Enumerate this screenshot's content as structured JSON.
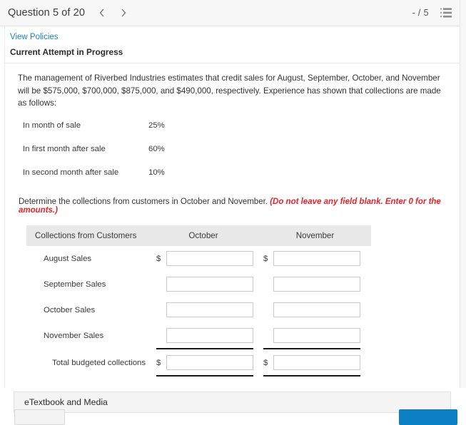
{
  "topbar": {
    "question_title": "Question 5 of 20",
    "prev_icon": "chevron-left-icon",
    "next_icon": "chevron-right-icon",
    "score": "- / 5",
    "menu_icon": "list-icon"
  },
  "header": {
    "policies_link": "View Policies",
    "attempt_status": "Current Attempt in Progress"
  },
  "question": {
    "prompt": "The management of Riverbed Industries estimates that credit sales for August, September, October, and November will be $575,000, $700,000, $875,000, and $490,000, respectively. Experience has shown that collections are made as follows:",
    "collection_terms": [
      {
        "label": "In month of sale",
        "value": "25%"
      },
      {
        "label": "In first month after sale",
        "value": "60%"
      },
      {
        "label": "In second month after sale",
        "value": "10%"
      }
    ],
    "instruction": "Determine the collections from customers in October and November.",
    "instruction_warning": "(Do not leave any field blank. Enter 0 for the amounts.)"
  },
  "collections_table": {
    "headers": {
      "row_label": "Collections from Customers",
      "col_october": "October",
      "col_november": "November"
    },
    "currency_symbol": "$",
    "rows": [
      {
        "label": "August Sales",
        "show_dollar": true,
        "october": "",
        "november": ""
      },
      {
        "label": "September Sales",
        "show_dollar": false,
        "october": "",
        "november": ""
      },
      {
        "label": "October Sales",
        "show_dollar": false,
        "october": "",
        "november": ""
      },
      {
        "label": "November Sales",
        "show_dollar": false,
        "october": "",
        "november": ""
      }
    ],
    "total_row": {
      "label": "Total budgeted collections",
      "show_dollar": true,
      "october": "",
      "november": ""
    },
    "input_placeholder": ""
  },
  "etextbook": {
    "label": "eTextbook and Media"
  },
  "footer": {
    "secondary_button": "",
    "primary_button": ""
  },
  "colors": {
    "link": "#1a7fc1",
    "warning": "#e8232a",
    "primary_button": "#0b7fc4",
    "table_header_bg": "#e8e8e8"
  }
}
